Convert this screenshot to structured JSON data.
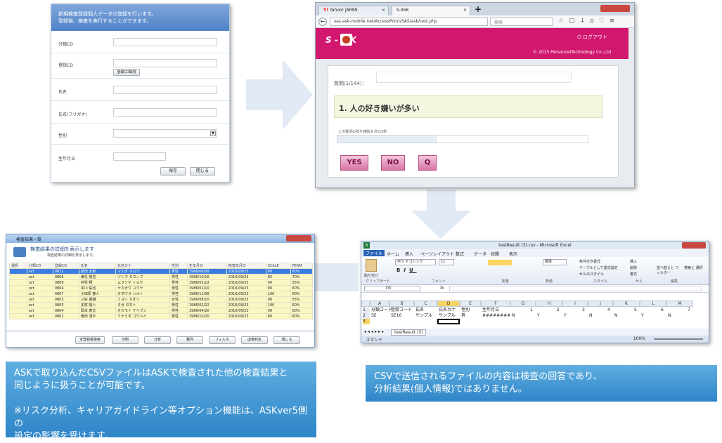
{
  "form": {
    "header_line1": "新規検査登録個人データの登録を行います。",
    "header_line2": "登録後、検査を実行することができます。",
    "fields": [
      {
        "label": "分類CD"
      },
      {
        "label": "登録CD",
        "button": "登録CD取得"
      },
      {
        "label": "氏名"
      },
      {
        "label": "氏名(フリガナ)"
      },
      {
        "label": "性別"
      },
      {
        "label": "生年月日"
      }
    ],
    "save_button": "保存",
    "close_button": "閉じる"
  },
  "browser": {
    "tab1": "Yahoo! JAPAN",
    "tab2": "S.ASK",
    "url": "sas.ask-mobile.net/AccessPoint/SAS/ask/test.php",
    "search_placeholder": "検索",
    "logo": "S - S K",
    "logout": "ログアウト",
    "copyright": "© 2015 PersonnelTechnology Co.,Ltd",
    "question_counter": "質問(1/144)：",
    "question": "1. 人の好き嫌いが多い",
    "timer": "この質問の残り時間:6 秒/10秒",
    "timer_progress": 0.4,
    "yes": "YES",
    "no": "NO",
    "q": "Q"
  },
  "list": {
    "window_title": "検査結果一覧",
    "heading": "検査結果の詳細を表示します",
    "subheading": "検査結果の詳細を表示します。",
    "columns": [
      "選択",
      "分類CD",
      "登録CD",
      "氏名",
      "氏名カナ",
      "性別",
      "生年月日",
      "検査年月日",
      "SCALE",
      "PERM"
    ],
    "rows": [
      [
        "",
        "oct",
        "0811",
        "前田 太郎",
        "マエダ タロウ",
        "男性",
        "1986/06/08",
        "2016/09/23",
        "80",
        "60%"
      ],
      [
        "",
        "oct",
        "0806",
        "津島 隆信",
        "ツシマ タカノブ",
        "男性",
        "1986/10/16",
        "2016/09/23",
        "85",
        "70%"
      ],
      [
        "",
        "oct",
        "0808",
        "村島 翔",
        "ムラシマ ショウ",
        "男性",
        "1986/03/22",
        "2016/09/23",
        "90",
        "55%"
      ],
      [
        "",
        "oct",
        "0804",
        "中川 佑也",
        "ナカガワ ユウヤ",
        "男性",
        "1986/02/10",
        "2016/09/23",
        "80",
        "60%"
      ],
      [
        "",
        "oct",
        "0807",
        "小田原 春人",
        "オダワラ ハルト",
        "男性",
        "1986/11/08",
        "2016/09/23",
        "100",
        "60%"
      ],
      [
        "",
        "oct",
        "0803",
        "三好 香織",
        "ミヨシ カオリ",
        "女性",
        "1986/08/10",
        "2016/09/23",
        "90",
        "55%"
      ],
      [
        "",
        "oct",
        "0805",
        "多賀 隆人",
        "タガ タカト",
        "男性",
        "1986/02/22",
        "2016/09/23",
        "100",
        "60%"
      ],
      [
        "",
        "oct",
        "0804",
        "岡本 恵文",
        "オカモト ケイブン",
        "男性",
        "1986/04/20",
        "2016/09/23",
        "90",
        "60%"
      ],
      [
        "",
        "oct",
        "0801",
        "南田 浩平",
        "ミナミダ コウヘイ",
        "男性",
        "1986/10/20",
        "2016/09/23",
        "80",
        "60%"
      ]
    ],
    "buttons": [
      "全登録者検索",
      "印刷",
      "分析",
      "整列",
      "フィルタ",
      "虚偽判定",
      "閉じる"
    ]
  },
  "excel": {
    "title": "testResult (3).csv - Microsoft Excel",
    "tabs": [
      "ファイル",
      "ホーム",
      "挿入",
      "ページレイアウト",
      "数式",
      "データ",
      "校閲",
      "表示"
    ],
    "font_name": "ＭＳ Ｐゴシック",
    "font_size": "11",
    "ribbon_groups": [
      "クリップボード",
      "フォント",
      "配置",
      "数値",
      "スタイル",
      "セル",
      "編集"
    ],
    "ribbon_items": {
      "paste": "貼り付け",
      "number_format": "標準",
      "conditional": "条件付き書式",
      "table": "テーブルとして書式設定",
      "cell_style": "セルのスタイル",
      "insert": "挿入",
      "delete": "削除",
      "format": "書式",
      "sort": "並べ替えと フィルター",
      "find": "検索と 選択"
    },
    "name_box": "D3",
    "fx": "fx",
    "columns": [
      "A",
      "B",
      "C",
      "D",
      "E",
      "F",
      "G",
      "H",
      "I",
      "J",
      "K",
      "L",
      "M"
    ],
    "row1": [
      "分類コード",
      "登録コード",
      "氏名",
      "氏名カナ",
      "性別",
      "生年月日",
      "1",
      "2",
      "3",
      "4",
      "5",
      "6",
      "7"
    ],
    "row2": [
      "SE",
      "SE16",
      "サンプル",
      "サンプル",
      "男",
      "########",
      "N",
      "Y",
      "Y",
      "N",
      "N",
      "Y",
      "N"
    ],
    "sheet_tab": "testResult (3)",
    "status": "コマンド",
    "zoom": "100%"
  },
  "captions": {
    "left_line1": "ASKで取り込んだCSVファイルはASKで検査された他の検査結果と",
    "left_line2": "同じように扱うことが可能です。",
    "left_line3": "※リスク分析、キャリアガイドライン等オプション機能は、ASKver5側の",
    "left_line4": "設定の影響を受けます。",
    "right_line1": "CSVで送信されるファイルの内容は検査の回答であり、",
    "right_line2": "分析結果(個人情報)ではありません。"
  },
  "colors": {
    "brand_pink": "#d2176e",
    "caption_blue": "#3d95d4",
    "arrow_blue": "#c9d8ec"
  }
}
